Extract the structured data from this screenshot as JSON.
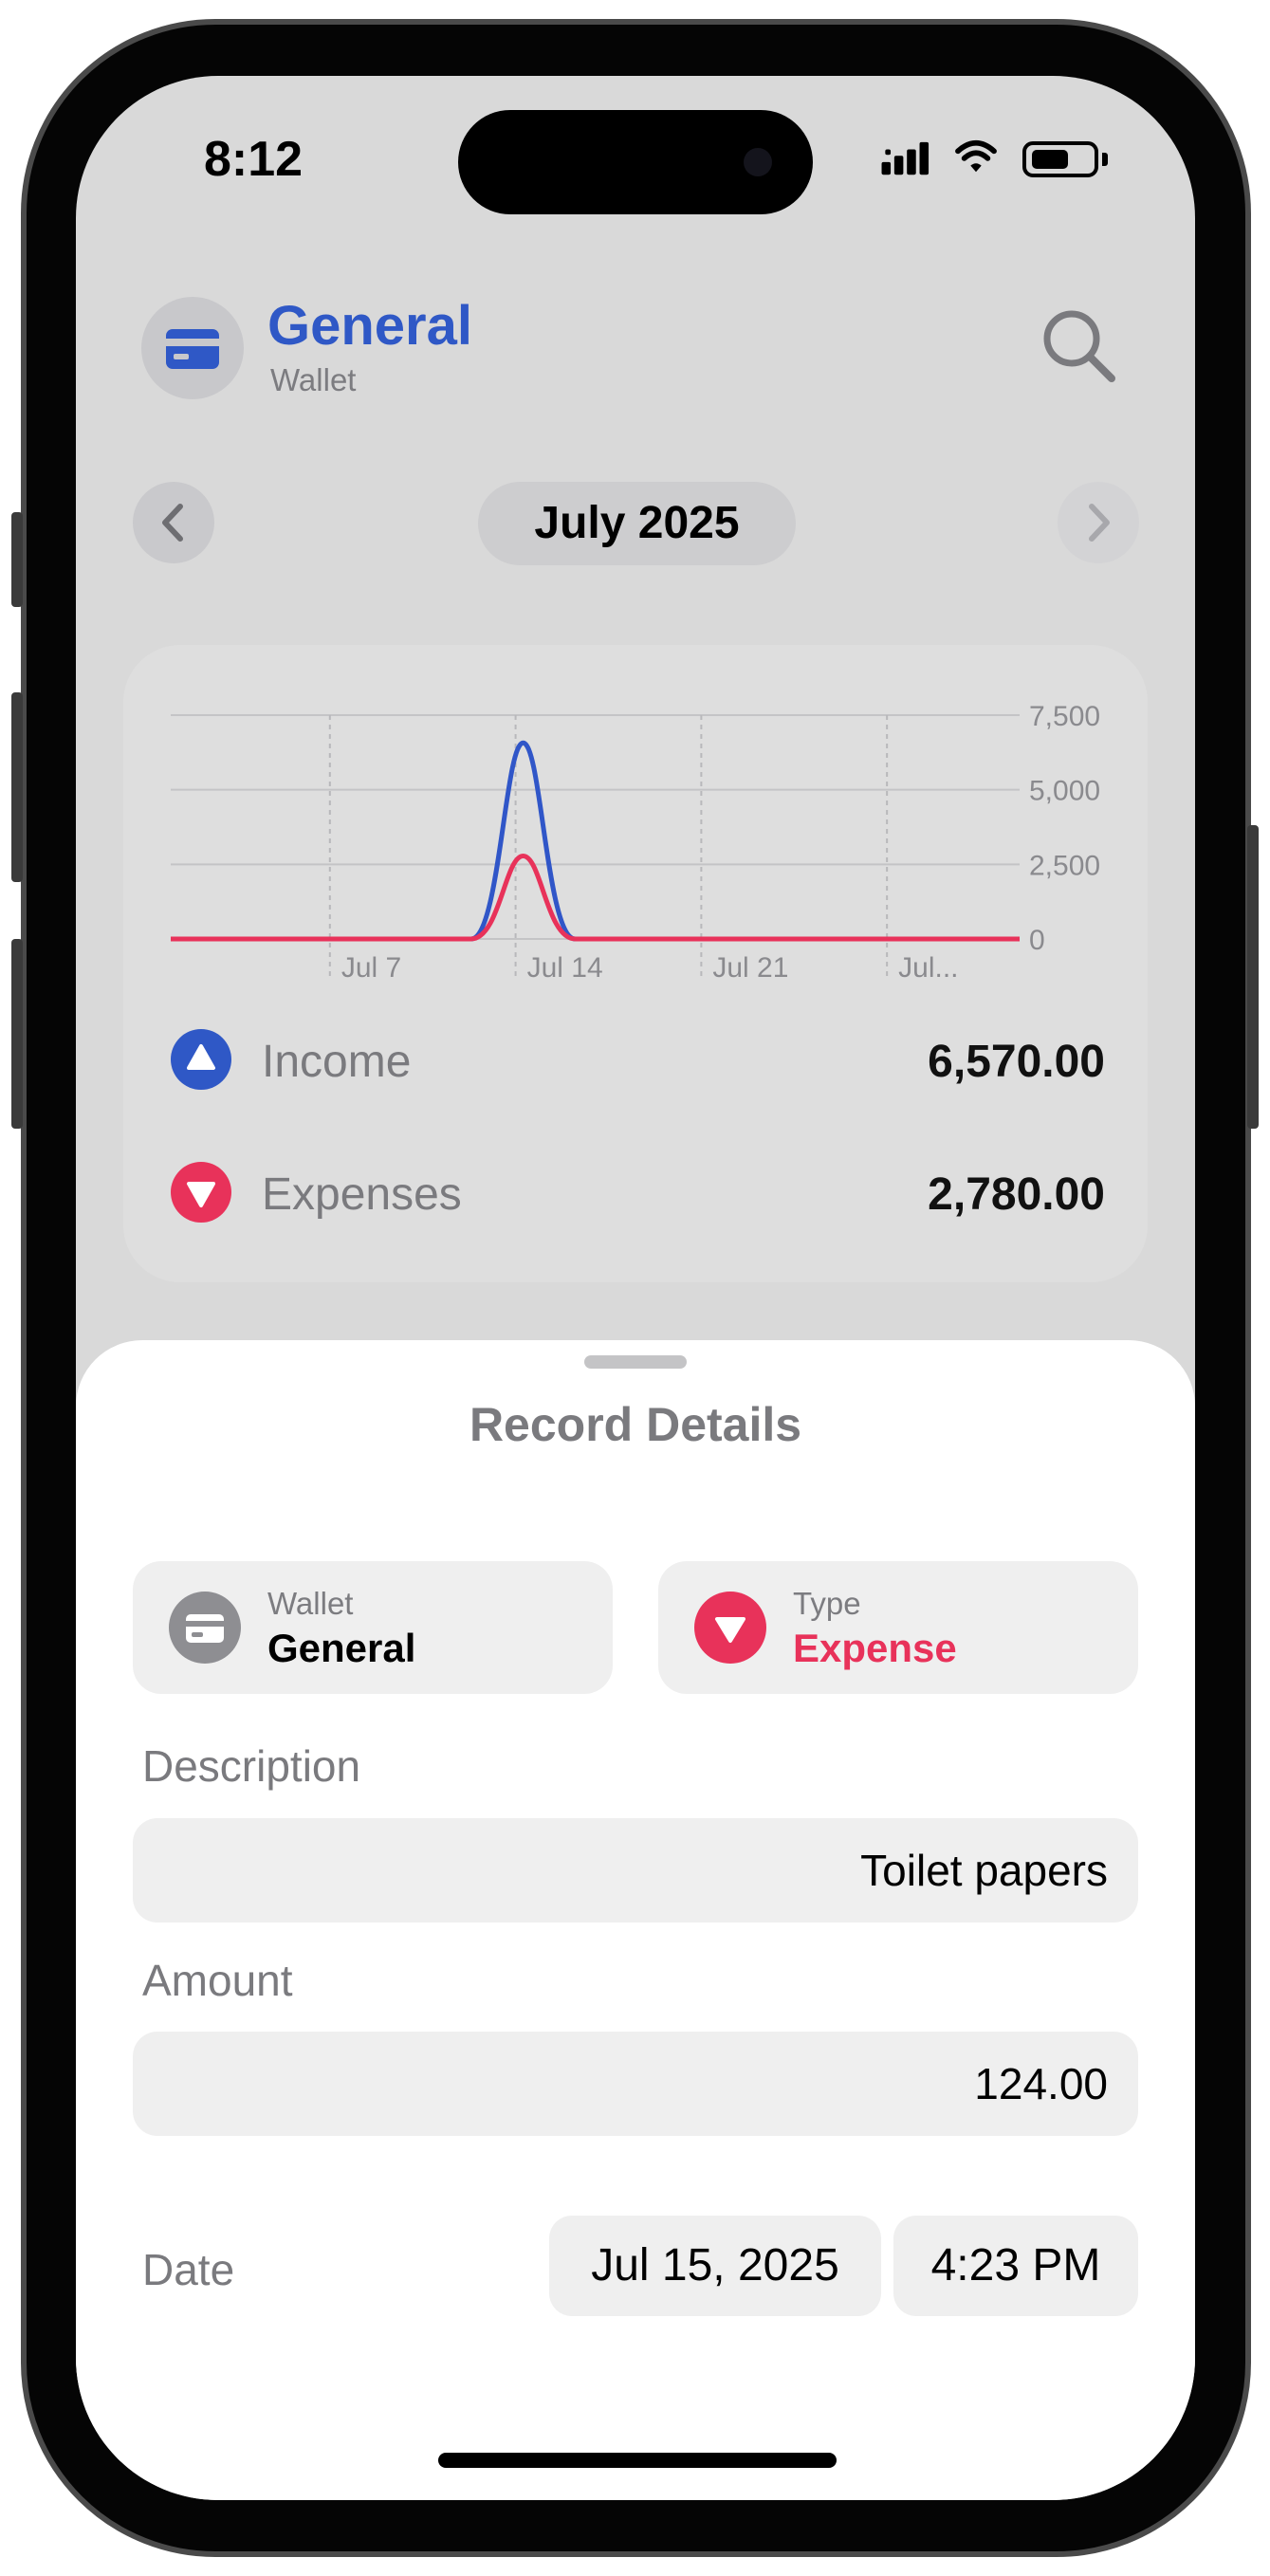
{
  "status_bar": {
    "time": "8:12"
  },
  "header": {
    "title": "General",
    "subtitle": "Wallet"
  },
  "month_nav": {
    "label": "July 2025"
  },
  "summary": {
    "income": {
      "label": "Income",
      "value": "6,570.00"
    },
    "expenses": {
      "label": "Expenses",
      "value": "2,780.00"
    }
  },
  "colors": {
    "accent_blue": "#2f58c6",
    "expense_red": "#e8325a",
    "income_line": "#3056c8",
    "expense_line": "#e8325a"
  },
  "icons": [
    "wallet-card-icon",
    "search-icon",
    "chevron-left-icon",
    "chevron-right-icon",
    "triangle-up-icon",
    "triangle-down-icon",
    "signal-icon",
    "wifi-icon",
    "battery-icon"
  ],
  "chart_data": {
    "type": "line",
    "x_tick_labels": [
      "Jul 7",
      "Jul 14",
      "Jul 21",
      "Jul..."
    ],
    "y_tick_labels": [
      "7,500",
      "5,000",
      "2,500",
      "0"
    ],
    "ylim": [
      0,
      7500
    ],
    "grid": true,
    "x_days": [
      1,
      2,
      3,
      4,
      5,
      6,
      7,
      8,
      9,
      10,
      11,
      12,
      13,
      14,
      15,
      16,
      17,
      18,
      19,
      20,
      21,
      22,
      23,
      24,
      25,
      26,
      27,
      28,
      29,
      30,
      31
    ],
    "series": [
      {
        "name": "Income",
        "color": "#3056c8",
        "peak_day": 15,
        "values": [
          0,
          0,
          0,
          0,
          0,
          0,
          0,
          0,
          0,
          0,
          0,
          0,
          0,
          0,
          6570,
          0,
          0,
          0,
          0,
          0,
          0,
          0,
          0,
          0,
          0,
          0,
          0,
          0,
          0,
          0,
          0
        ]
      },
      {
        "name": "Expenses",
        "color": "#e8325a",
        "peak_day": 15,
        "values": [
          0,
          0,
          0,
          0,
          0,
          0,
          0,
          0,
          0,
          0,
          0,
          0,
          0,
          0,
          2780,
          0,
          0,
          0,
          0,
          0,
          0,
          0,
          0,
          0,
          0,
          0,
          0,
          0,
          0,
          0,
          0
        ]
      }
    ]
  },
  "sheet": {
    "title": "Record Details",
    "wallet_tile": {
      "label": "Wallet",
      "value": "General"
    },
    "type_tile": {
      "label": "Type",
      "value": "Expense"
    },
    "description": {
      "label": "Description",
      "value": "Toilet papers"
    },
    "amount": {
      "label": "Amount",
      "value": "124.00"
    },
    "date": {
      "label": "Date",
      "date_value": "Jul 15, 2025",
      "time_value": "4:23 PM"
    }
  }
}
